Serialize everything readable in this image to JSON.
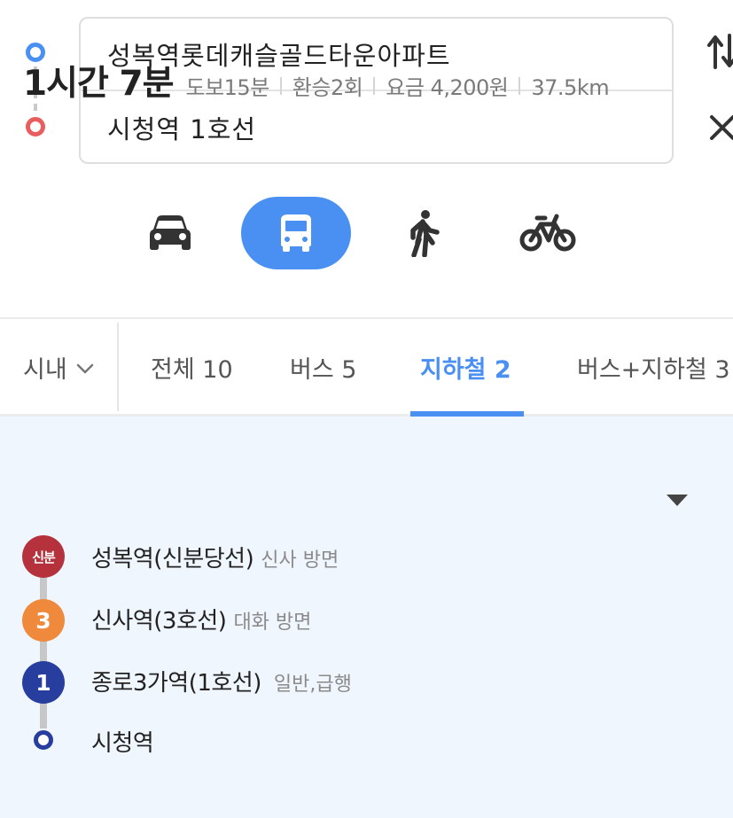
{
  "route": {
    "origin": "성복역롯데캐슬골드타운아파트",
    "destination": "시청역 1호선"
  },
  "modes": [
    {
      "name": "car",
      "icon": "car-icon",
      "active": false
    },
    {
      "name": "transit",
      "icon": "bus-icon",
      "active": true
    },
    {
      "name": "walk",
      "icon": "walk-icon",
      "active": false
    },
    {
      "name": "bike",
      "icon": "bike-icon",
      "active": false
    }
  ],
  "filters": {
    "region": "시내",
    "tabs": [
      "전체 10",
      "버스 5",
      "지하철 2",
      "버스+지하철 3"
    ],
    "active_tab": "지하철 2"
  },
  "result": {
    "duration": "1시간 7분",
    "walk": "도보15분",
    "transfers": "환승2회",
    "fare": "요금 4,200원",
    "distance": "37.5km",
    "stops": [
      {
        "badge": "신분",
        "name": "성복역(신분당선)",
        "direction": "신사 방면",
        "color": "#b5313c"
      },
      {
        "badge": "3",
        "name": "신사역(3호선)",
        "direction": "대화 방면",
        "color": "#ef8a3d"
      },
      {
        "badge": "1",
        "name": "종로3가역(1호선)",
        "direction": "일반,급행",
        "color": "#273e9e"
      },
      {
        "badge": "",
        "name": "시청역",
        "direction": "",
        "color": "#273e9e"
      }
    ]
  },
  "colors": {
    "accent": "#4a90f2",
    "origin_marker": "#4a90f2",
    "destination_marker": "#e85d5d",
    "card_background": "#f0f6fe"
  }
}
